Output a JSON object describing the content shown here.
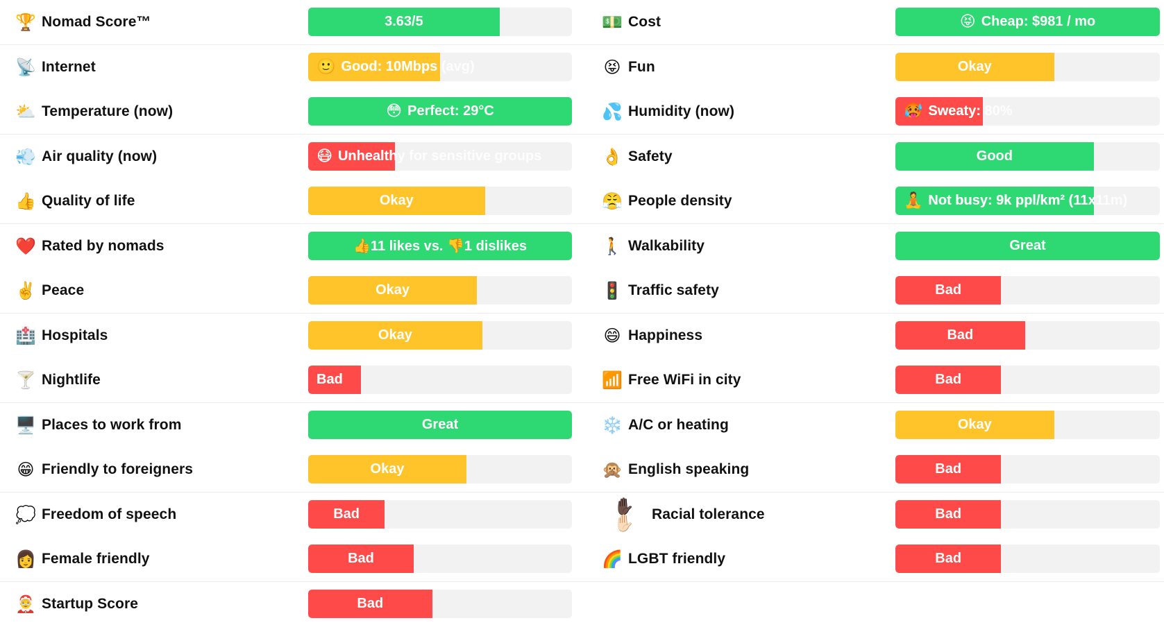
{
  "colors": {
    "great": "#2ed872",
    "okay": "#ffc42a",
    "bad": "#ff4a4a",
    "track": "#f2f2f2"
  },
  "left": [
    {
      "icon": "🏆",
      "icon_name": "trophy-icon",
      "label": "Nomad Score™",
      "value": "3.63/5",
      "level": "great",
      "fill": 0.726
    },
    {
      "icon": "📡",
      "icon_name": "satellite-dish-icon",
      "label": "Internet",
      "emoji": "🙂",
      "value": "Good: 10Mbps (avg)",
      "level": "okay",
      "fill": 0.5,
      "align": "left"
    },
    {
      "icon": "⛅",
      "icon_name": "sun-behind-cloud-icon",
      "label": "Temperature (now)",
      "emoji": "😳",
      "value": "Perfect: 29°C",
      "level": "great",
      "fill": 1.0
    },
    {
      "icon": "💨",
      "icon_name": "wind-icon",
      "label": "Air quality (now)",
      "emoji": "😷",
      "value": "Unhealthy for sensitive groups",
      "level": "bad",
      "fill": 0.33,
      "align": "left"
    },
    {
      "icon": "👍",
      "icon_name": "thumbs-up-icon",
      "label": "Quality of life",
      "value": "Okay",
      "level": "okay",
      "fill": 0.67
    },
    {
      "icon": "❤️",
      "icon_name": "heart-icon",
      "label": "Rated by nomads",
      "value": "👍11 likes vs. 👎1 dislikes",
      "level": "great",
      "fill": 1.0
    },
    {
      "icon": "✌️",
      "icon_name": "peace-hand-icon",
      "label": "Peace",
      "value": "Okay",
      "level": "okay",
      "fill": 0.64
    },
    {
      "icon": "🏥",
      "icon_name": "hospital-icon",
      "label": "Hospitals",
      "value": "Okay",
      "level": "okay",
      "fill": 0.66
    },
    {
      "icon": "🍸",
      "icon_name": "cocktail-icon",
      "label": "Nightlife",
      "value": "Bad",
      "level": "bad",
      "fill": 0.2,
      "align": "left"
    },
    {
      "icon": "🖥️",
      "icon_name": "desktop-computer-icon",
      "label": "Places to work from",
      "value": "Great",
      "level": "great",
      "fill": 1.0
    },
    {
      "icon": "😁",
      "icon_name": "grinning-face-icon",
      "label": "Friendly to foreigners",
      "value": "Okay",
      "level": "okay",
      "fill": 0.6
    },
    {
      "icon": "💭",
      "icon_name": "speech-bubble-icon",
      "label": "Freedom of speech",
      "value": "Bad",
      "level": "bad",
      "fill": 0.29
    },
    {
      "icon": "👩",
      "icon_name": "woman-icon",
      "label": "Female friendly",
      "value": "Bad",
      "level": "bad",
      "fill": 0.4
    },
    {
      "icon": "🤶",
      "icon_name": "startup-person-icon",
      "label": "Startup Score",
      "value": "Bad",
      "level": "bad",
      "fill": 0.47
    }
  ],
  "right": [
    {
      "icon": "💵",
      "icon_name": "money-icon",
      "label": "Cost",
      "emoji": "😝",
      "value": "Cheap: $981 / mo",
      "level": "great",
      "fill": 1.0
    },
    {
      "icon": "😝",
      "icon_name": "tongue-face-icon",
      "label": "Fun",
      "value": "Okay",
      "level": "okay",
      "fill": 0.6
    },
    {
      "icon": "💦",
      "icon_name": "sweat-droplets-icon",
      "label": "Humidity (now)",
      "emoji": "🥵",
      "value": "Sweaty: 80%",
      "level": "bad",
      "fill": 0.33,
      "align": "left"
    },
    {
      "icon": "👌",
      "icon_name": "ok-hand-icon",
      "label": "Safety",
      "value": "Good",
      "level": "great",
      "fill": 0.75
    },
    {
      "icon": "😤",
      "icon_name": "huffing-face-icon",
      "label": "People density",
      "emoji": "🧘",
      "value": "Not busy: 9k ppl/km² (11x11m)",
      "level": "great",
      "fill": 0.75,
      "align": "left"
    },
    {
      "icon": "🚶",
      "icon_name": "walking-person-icon",
      "label": "Walkability",
      "value": "Great",
      "level": "great",
      "fill": 1.0
    },
    {
      "icon": "🚦",
      "icon_name": "traffic-light-icon",
      "label": "Traffic safety",
      "value": "Bad",
      "level": "bad",
      "fill": 0.4
    },
    {
      "icon": "😄",
      "icon_name": "smiling-face-icon",
      "label": "Happiness",
      "value": "Bad",
      "level": "bad",
      "fill": 0.49
    },
    {
      "icon": "📶",
      "icon_name": "signal-bars-icon",
      "label": "Free WiFi in city",
      "value": "Bad",
      "level": "bad",
      "fill": 0.4
    },
    {
      "icon": "❄️",
      "icon_name": "snowflake-icon",
      "label": "A/C or heating",
      "value": "Okay",
      "level": "okay",
      "fill": 0.6
    },
    {
      "icon": "🙊",
      "icon_name": "speak-no-evil-monkey-icon",
      "label": "English speaking",
      "value": "Bad",
      "level": "bad",
      "fill": 0.4
    },
    {
      "icon": "✋🏿 ✋🏻",
      "icon_name": "raised-hands-icon",
      "label": "Racial tolerance",
      "value": "Bad",
      "level": "bad",
      "fill": 0.4,
      "wide": true
    },
    {
      "icon": "🌈",
      "icon_name": "rainbow-icon",
      "label": "LGBT friendly",
      "value": "Bad",
      "level": "bad",
      "fill": 0.4
    }
  ]
}
